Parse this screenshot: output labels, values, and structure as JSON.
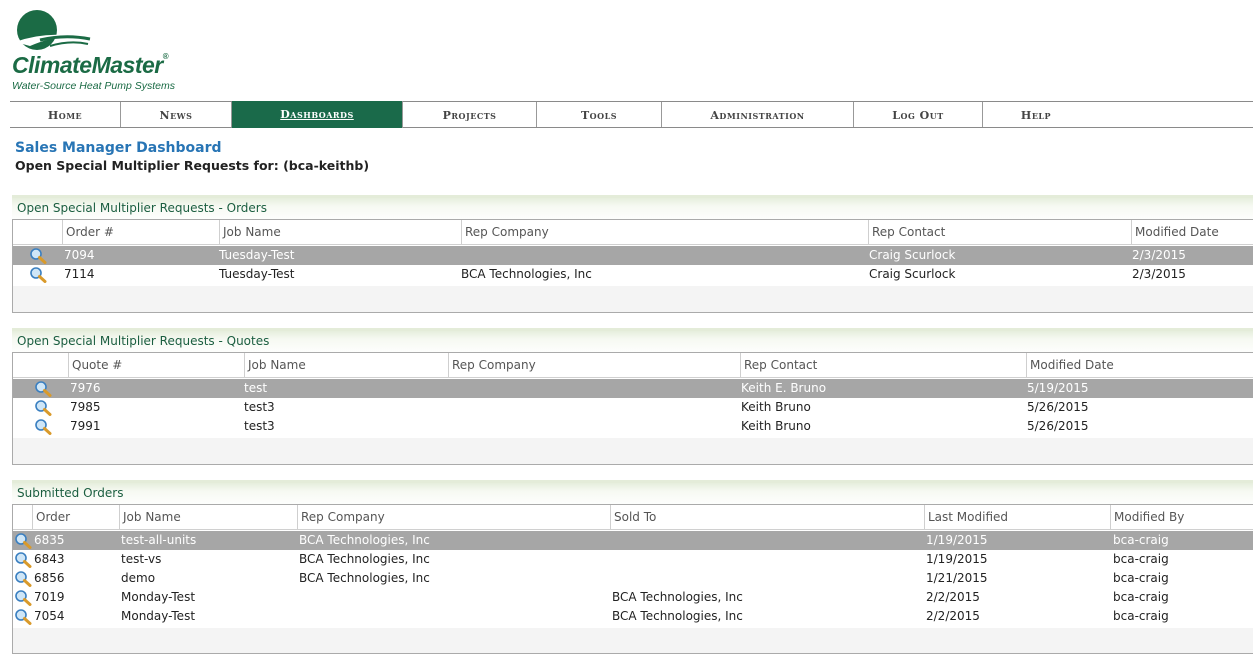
{
  "brand": {
    "name": "ClimateMaster",
    "reg": "®",
    "tagline": "Water-Source Heat Pump Systems"
  },
  "nav": [
    {
      "label": "Home"
    },
    {
      "label": "News"
    },
    {
      "label": "Dashboards"
    },
    {
      "label": "Projects"
    },
    {
      "label": "Tools"
    },
    {
      "label": "Administration"
    },
    {
      "label": "Log Out"
    },
    {
      "label": "Help"
    }
  ],
  "page": {
    "title": "Sales Manager Dashboard",
    "subtitle": "Open Special Multiplier Requests for: (bca-keithb)"
  },
  "orders": {
    "section_title": "Open Special Multiplier Requests - Orders",
    "columns": [
      "Order #",
      "Job Name",
      "Rep Company",
      "Rep Contact",
      "Modified Date"
    ],
    "rows": [
      [
        "7094",
        "Tuesday-Test",
        "",
        "Craig Scurlock",
        "2/3/2015"
      ],
      [
        "7114",
        "Tuesday-Test",
        "BCA Technologies, Inc",
        "Craig Scurlock",
        "2/3/2015"
      ]
    ]
  },
  "quotes": {
    "section_title": "Open Special Multiplier Requests - Quotes",
    "columns": [
      "Quote #",
      "Job Name",
      "Rep Company",
      "Rep Contact",
      "Modified Date"
    ],
    "rows": [
      [
        "7976",
        "test",
        "",
        "Keith E. Bruno",
        "5/19/2015"
      ],
      [
        "7985",
        "test3",
        "",
        "Keith Bruno",
        "5/26/2015"
      ],
      [
        "7991",
        "test3",
        "",
        "Keith Bruno",
        "5/26/2015"
      ]
    ]
  },
  "submitted": {
    "section_title": "Submitted Orders",
    "columns": [
      "Order",
      "Job Name",
      "Rep Company",
      "Sold To",
      "Last Modified",
      "Modified By"
    ],
    "rows": [
      [
        "6835",
        "test-all-units",
        "BCA Technologies, Inc",
        "",
        "1/19/2015",
        "bca-craig"
      ],
      [
        "6843",
        "test-vs",
        "BCA Technologies, Inc",
        "",
        "1/19/2015",
        "bca-craig"
      ],
      [
        "6856",
        "demo",
        "BCA Technologies, Inc",
        "",
        "1/21/2015",
        "bca-craig"
      ],
      [
        "7019",
        "Monday-Test",
        "",
        "BCA Technologies, Inc",
        "2/2/2015",
        "bca-craig"
      ],
      [
        "7054",
        "Monday-Test",
        "",
        "BCA Technologies, Inc",
        "2/2/2015",
        "bca-craig"
      ]
    ]
  },
  "colors": {
    "brand_green": "#1b6b45",
    "active_nav": "#1a6a4a",
    "title_blue": "#2875b5",
    "selected_row": "#a6a6a6"
  },
  "icons": {
    "view": "magnifier-icon"
  }
}
